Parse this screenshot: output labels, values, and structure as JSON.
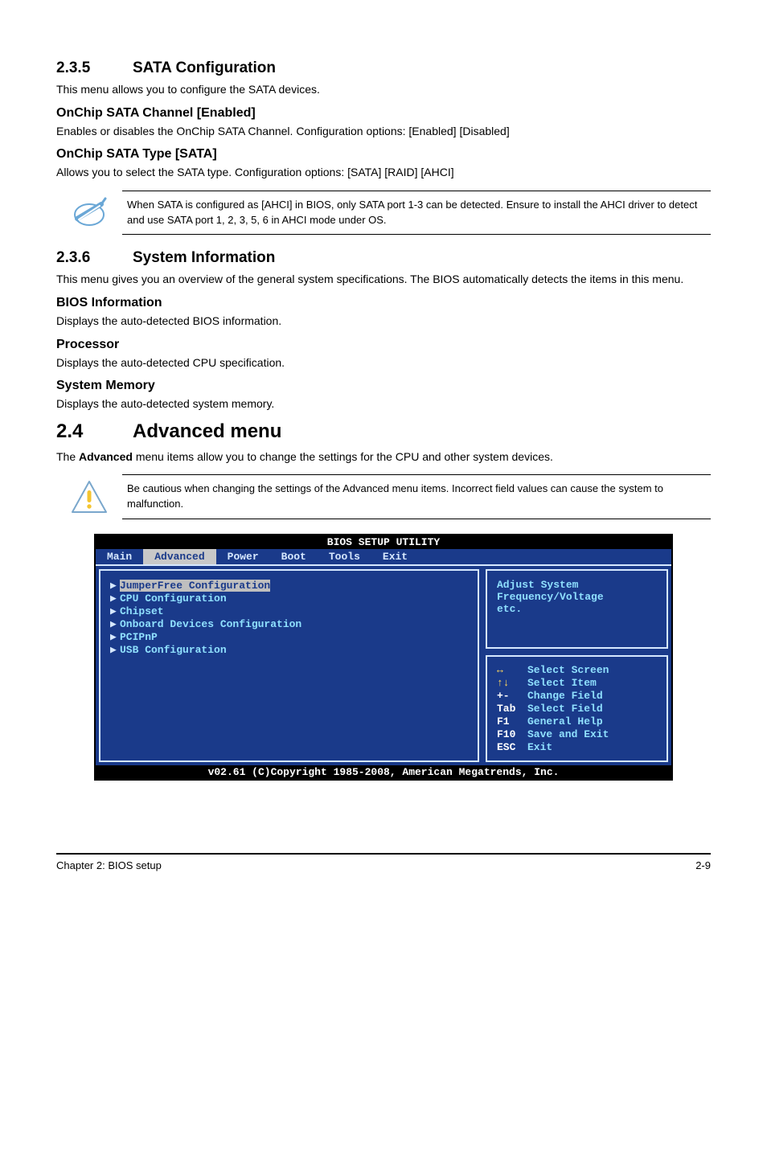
{
  "s235": {
    "num": "2.3.5",
    "title": "SATA Configuration",
    "intro": "This menu allows you to configure the SATA devices.",
    "sub1_title": "OnChip SATA Channel [Enabled]",
    "sub1_body": "Enables or disables the OnChip SATA Channel. Configuration options: [Enabled] [Disabled]",
    "sub2_title": "OnChip SATA Type [SATA]",
    "sub2_body": "Allows you to select the SATA type. Configuration options: [SATA] [RAID] [AHCI]",
    "note": "When SATA is configured as [AHCI] in BIOS, only SATA port 1-3 can be detected. Ensure to install the AHCI driver to detect and use SATA port 1, 2, 3, 5, 6 in AHCI mode under OS."
  },
  "s236": {
    "num": "2.3.6",
    "title": "System Information",
    "intro": "This menu gives you an overview of the general system specifications. The BIOS automatically detects the items in this menu.",
    "bios_info_title": "BIOS Information",
    "bios_info_body": "Displays the auto-detected BIOS information.",
    "proc_title": "Processor",
    "proc_body": "Displays the auto-detected CPU specification.",
    "mem_title": "System Memory",
    "mem_body": "Displays the auto-detected system memory."
  },
  "s24": {
    "num": "2.4",
    "title": "Advanced menu",
    "intro_pre": "The ",
    "intro_bold": "Advanced",
    "intro_post": " menu items allow you to change the settings for the CPU and other system devices.",
    "caution": "Be cautious when changing the settings of the Advanced menu items. Incorrect field values can cause the system to malfunction."
  },
  "bios": {
    "title": "BIOS SETUP UTILITY",
    "tabs": [
      "Main",
      "Advanced",
      "Power",
      "Boot",
      "Tools",
      "Exit"
    ],
    "selected_tab": 1,
    "menu": [
      "JumperFree Configuration",
      "CPU Configuration",
      "Chipset",
      "Onboard Devices Configuration",
      "PCIPnP",
      "USB Configuration"
    ],
    "help": [
      "Adjust System",
      "Frequency/Voltage",
      "etc."
    ],
    "legend": [
      {
        "key": "↔",
        "key_class": "yellow",
        "desc": "Select Screen"
      },
      {
        "key": "↑↓",
        "key_class": "yellow",
        "desc": "Select Item"
      },
      {
        "key": "+-",
        "key_class": "",
        "desc": "Change Field"
      },
      {
        "key": "Tab",
        "key_class": "",
        "desc": "Select Field"
      },
      {
        "key": "F1",
        "key_class": "",
        "desc": "General Help"
      },
      {
        "key": "F10",
        "key_class": "",
        "desc": "Save and Exit"
      },
      {
        "key": "ESC",
        "key_class": "",
        "desc": "Exit"
      }
    ],
    "footer": "v02.61 (C)Copyright 1985-2008, American Megatrends, Inc."
  },
  "footer": {
    "left": "Chapter 2: BIOS setup",
    "right": "2-9"
  }
}
